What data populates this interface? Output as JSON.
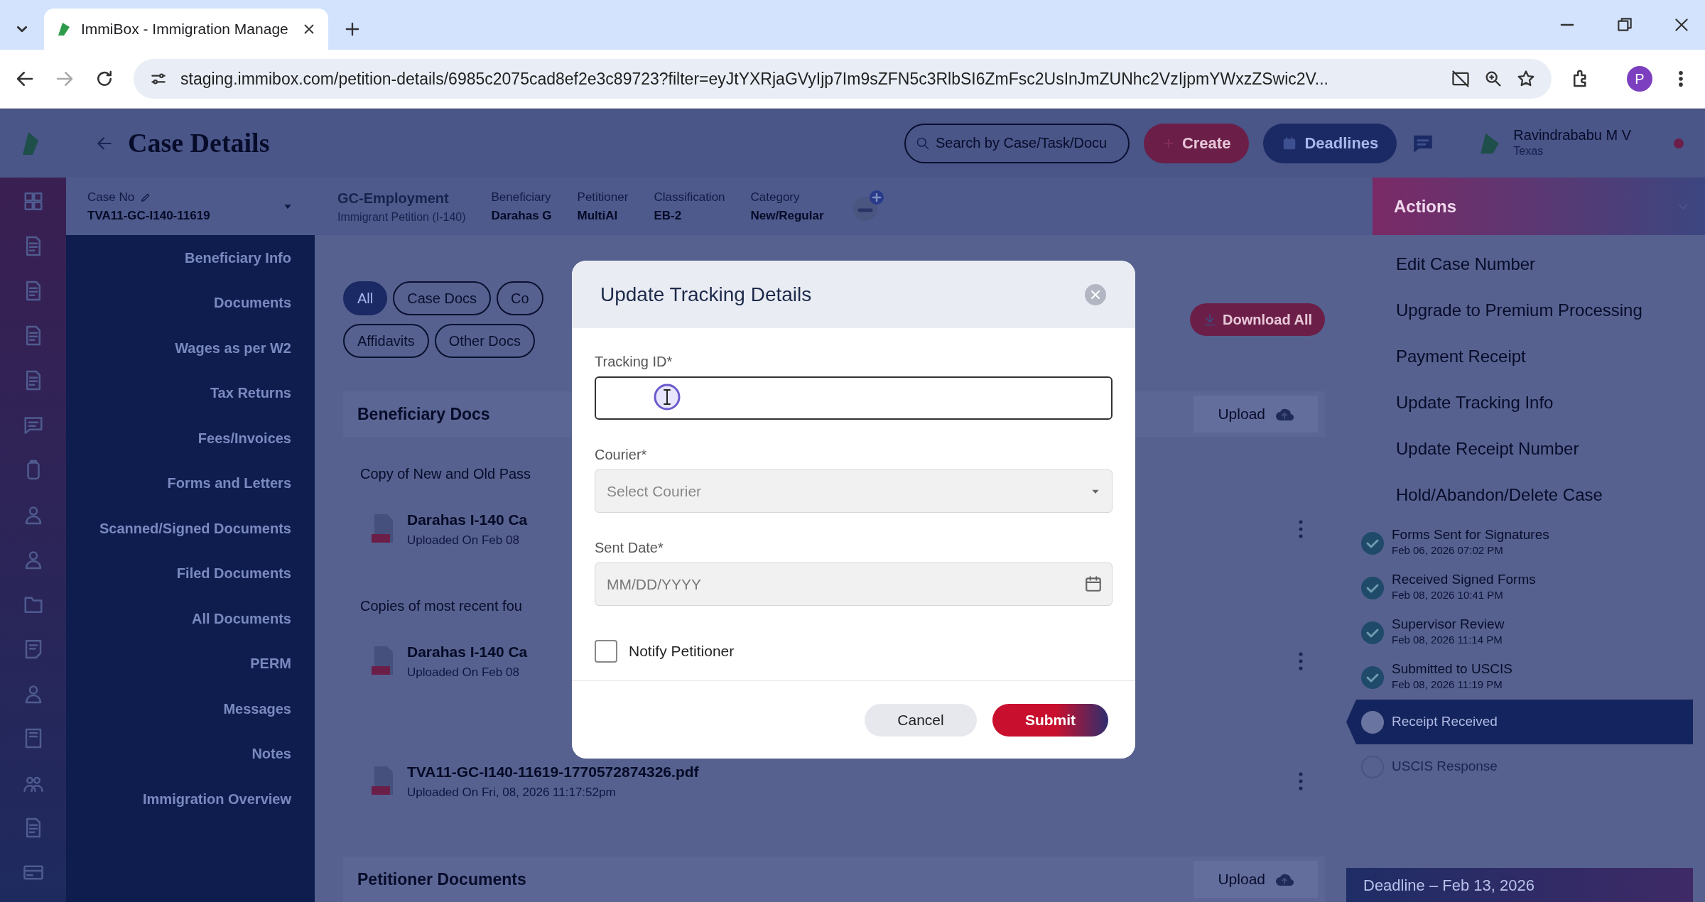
{
  "browser": {
    "tab_title": "ImmiBox - Immigration Manage",
    "url": "staging.immibox.com/petition-details/6985c2075cad8ef2e3c89723?filter=eyJtYXRjaGVyIjp7Im9sZFN5c3RlbSI6ZmFsc2UsInJmZUNhc2VzIjpmYWxzZSwic2V...",
    "profile_initial": "P"
  },
  "header": {
    "title": "Case Details",
    "search": {
      "placeholder": "Search by Case/Task/Docu"
    },
    "buttons": [
      {
        "label": "Create",
        "kind": "create"
      },
      {
        "label": "Deadlines",
        "kind": "deadlines"
      }
    ],
    "user": {
      "name": "Ravindrababu M V",
      "location": "Texas"
    }
  },
  "case_bar": {
    "case_label": "Case No",
    "case_number": "TVA11-GC-I140-11619",
    "type": "GC-Employment",
    "subtype": "Immigrant Petition (I-140)",
    "fields": [
      {
        "label": "Beneficiary",
        "value": "Darahas G"
      },
      {
        "label": "Petitioner",
        "value": "MultiAI"
      },
      {
        "label": "Classification",
        "value": "EB-2"
      },
      {
        "label": "Category",
        "value": "New/Regular"
      }
    ]
  },
  "sidebar": {
    "items": [
      "Beneficiary Info",
      "Documents",
      "Wages as per W2",
      "Tax Returns",
      "Fees/Invoices",
      "Forms and Letters",
      "Scanned/Signed Documents",
      "Filed Documents",
      "All Documents",
      "PERM",
      "Messages",
      "Notes",
      "Immigration Overview"
    ]
  },
  "filters": [
    [
      {
        "label": "All",
        "selected": true
      },
      {
        "label": "Case Docs",
        "selected": false
      },
      {
        "label": "Co",
        "selected": false
      }
    ],
    [
      {
        "label": "Affidavits",
        "selected": false
      },
      {
        "label": "Other Docs",
        "selected": false
      }
    ]
  ],
  "download_all": "Download All",
  "sections": [
    {
      "title": "Beneficiary Docs",
      "upload": "Upload",
      "groups": [
        {
          "title": "Copy of New and Old Pass",
          "docs": [
            {
              "name": "Darahas I-140 Ca",
              "meta": "Uploaded On Feb 08"
            }
          ]
        },
        {
          "title": "Copies of most recent fou",
          "docs": [
            {
              "name": "Darahas I-140 Ca",
              "meta": "Uploaded On Feb 08"
            }
          ]
        },
        {
          "docs": [
            {
              "name": "TVA11-GC-I140-11619-1770572874326.pdf",
              "meta": "Uploaded On Fri, 08, 2026 11:17:52pm"
            }
          ]
        }
      ]
    },
    {
      "title": "Petitioner Documents",
      "upload": "Upload"
    }
  ],
  "actions": {
    "title": "Actions",
    "items": [
      "Edit Case Number",
      "Upgrade to Premium Processing",
      "Payment Receipt",
      "Update Tracking Info",
      "Update Receipt Number",
      "Hold/Abandon/Delete Case"
    ],
    "timeline": [
      {
        "label": "Forms Sent for Signatures",
        "date": "Feb 06, 2026 07:02 PM",
        "kind": "done"
      },
      {
        "label": "Received Signed Forms",
        "date": "Feb 08, 2026 10:41 PM",
        "kind": "done"
      },
      {
        "label": "Supervisor Review",
        "date": "Feb 08, 2026 11:14 PM",
        "kind": "done"
      },
      {
        "label": "Submitted to USCIS",
        "date": "Feb 08, 2026 11:19 PM",
        "kind": "done"
      },
      {
        "label": "Receipt Received",
        "kind": "current"
      },
      {
        "label": "USCIS Response",
        "kind": "pending"
      }
    ],
    "deadline": "Deadline – Feb 13, 2026"
  },
  "modal": {
    "title": "Update Tracking Details",
    "fields": [
      {
        "label": "Tracking ID*",
        "kind": "text",
        "focused": true
      },
      {
        "label": "Courier*",
        "kind": "select",
        "placeholder": "Select Courier",
        "focused": false
      },
      {
        "label": "Sent Date*",
        "kind": "date",
        "placeholder": "MM/DD/YYYY",
        "focused": false
      }
    ],
    "notify": {
      "label": "Notify Petitioner",
      "checked": false
    },
    "buttons": [
      {
        "label": "Cancel",
        "kind": "cancel"
      },
      {
        "label": "Submit",
        "kind": "submit"
      }
    ]
  }
}
